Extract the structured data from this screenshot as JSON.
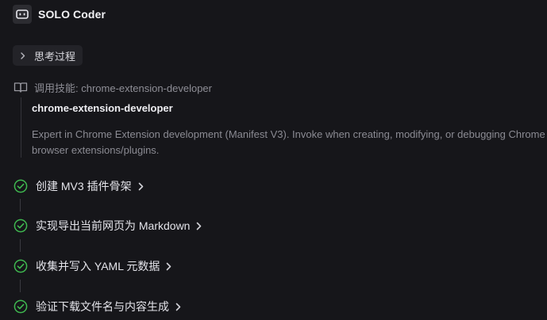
{
  "app": {
    "title": "SOLO Coder"
  },
  "thinking": {
    "label": "思考过程"
  },
  "skill": {
    "invocation": "调用技能: chrome-extension-developer",
    "name": "chrome-extension-developer",
    "description": "Expert in Chrome Extension development (Manifest V3). Invoke when creating, modifying, or debugging Chrome browser extensions/plugins."
  },
  "steps": [
    {
      "title": "创建 MV3 插件骨架",
      "status": "done"
    },
    {
      "title": "实现导出当前网页为 Markdown",
      "status": "done"
    },
    {
      "title": "收集并写入 YAML 元数据",
      "status": "done"
    },
    {
      "title": "验证下载文件名与内容生成",
      "status": "done"
    }
  ],
  "colors": {
    "background": "#16161a",
    "success": "#3fb950",
    "muted_text": "#8e8e96"
  },
  "icons": {
    "app": "robot-face-icon",
    "thinking": "chevron-right-icon",
    "skill": "book-open-icon",
    "step_status": "check-circle-icon",
    "step_expand": "chevron-right-icon"
  }
}
